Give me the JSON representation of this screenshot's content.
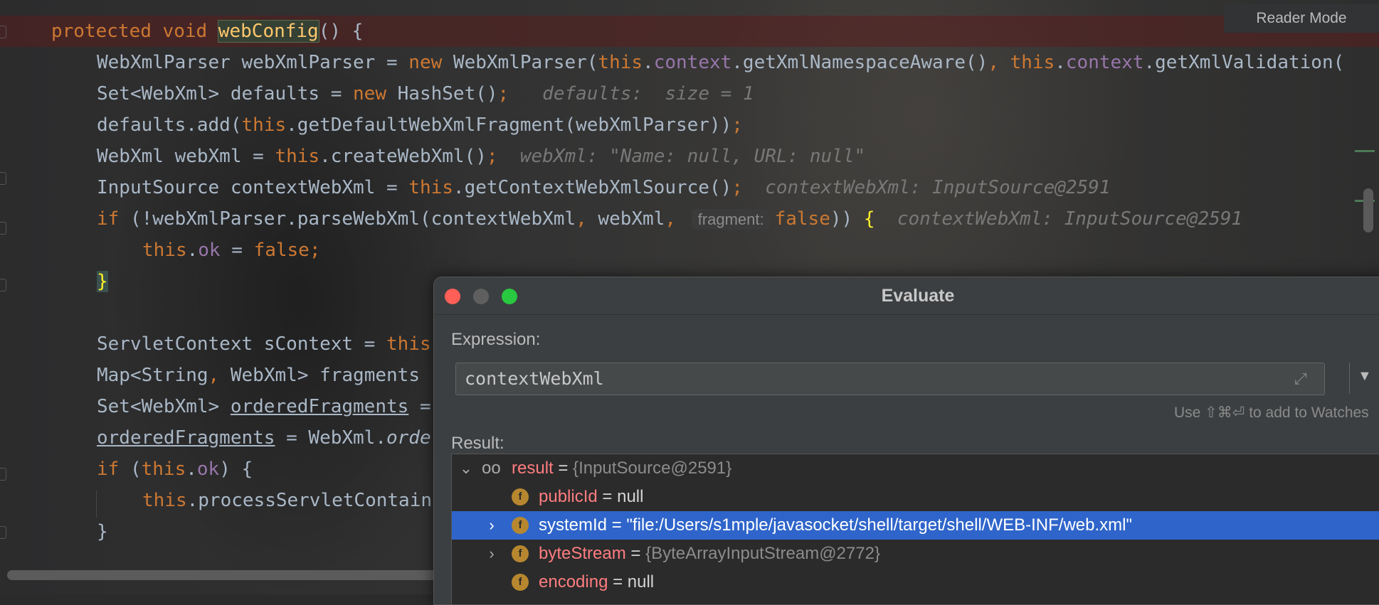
{
  "editor": {
    "reader_mode": "Reader Mode",
    "lines": {
      "l1": {
        "kw1": "protected",
        "kw2": "void",
        "method": "webConfig",
        "rest": "() {"
      },
      "l2": {
        "a": "WebXmlParser webXmlParser = ",
        "kw": "new",
        "b": " WebXmlParser(",
        "this1": "this",
        ".": ".",
        "f1": "context",
        "c": ".getXmlNamespaceAware()",
        ",": ", ",
        "this2": "this",
        "dot2": ".",
        "f2": "context",
        "d": ".getXmlValidation("
      },
      "l3": {
        "a": "Set<WebXml> defaults = ",
        "kw": "new",
        "b": " HashSet()",
        "semi": ";",
        "hint": "defaults:  size = 1"
      },
      "l4": {
        "a": "defaults.add(",
        "this": "this",
        "b": ".getDefaultWebXmlFragment(webXmlParser))",
        "semi": ";"
      },
      "l5": {
        "a": "WebXml webXml = ",
        "this": "this",
        "b": ".createWebXml()",
        "semi": ";",
        "hint": "webXml: \"Name: null, URL: null\""
      },
      "l6": {
        "a": "InputSource contextWebXml = ",
        "this": "this",
        "b": ".getContextWebXmlSource()",
        "semi": ";",
        "hint": "contextWebXml: InputSource@2591"
      },
      "l7": {
        "kw": "if",
        "a": " (!webXmlParser.parseWebXml(contextWebXml",
        ",": ", ",
        "b": "webXml",
        ",2": ", ",
        "inlay": "fragment:",
        "false": "false",
        "c": ")) ",
        "brace": "{",
        "hint": "contextWebXml: InputSource@2591"
      },
      "l8": {
        "this": "this",
        ".": ".",
        "f": "ok",
        "a": " = ",
        "false": "false",
        "semi": ";"
      },
      "l9": {
        "brace": "}"
      },
      "l10": {
        "a": "ServletContext sContext = ",
        "this": "this"
      },
      "l11": {
        "a": "Map<String",
        ",": ", ",
        "b": "WebXml> fragments"
      },
      "l12": {
        "a": "Set<WebXml> ",
        "u": "orderedFragments",
        "b": " ="
      },
      "l13": {
        "u": "orderedFragments",
        "a": " = WebXml.",
        "it": "orde"
      },
      "l14": {
        "kw": "if",
        "a": " (",
        "this": "this",
        ".": ".",
        "f": "ok",
        "b": ") {"
      },
      "l15": {
        "this": "this",
        "a": ".processServletContain"
      },
      "l16": {
        "brace": "}"
      }
    }
  },
  "dialog": {
    "title": "Evaluate",
    "expression_label": "Expression:",
    "expression_value": "contextWebXml",
    "watch_hint": "Use ⇧⌘⏎ to add to Watches",
    "result_label": "Result:",
    "rows": [
      {
        "name": "result",
        "eq": " = ",
        "value": "{InputSource@2591}",
        "expanded": true
      },
      {
        "name": "publicId",
        "eq": " = ",
        "value": "null"
      },
      {
        "name": "systemId",
        "eq": " = ",
        "value": "\"file:/Users/s1mple/javasocket/shell/target/shell/WEB-INF/web.xml\"",
        "selected": true
      },
      {
        "name": "byteStream",
        "eq": " = ",
        "value": "{ByteArrayInputStream@2772}"
      },
      {
        "name": "encoding",
        "eq": " = ",
        "value": "null"
      }
    ],
    "field_icon_letter": "f",
    "icons": {
      "expand": "expand-icon",
      "dropdown": "chevron-down-icon",
      "watch": "glasses-icon",
      "field": "field-icon"
    }
  }
}
